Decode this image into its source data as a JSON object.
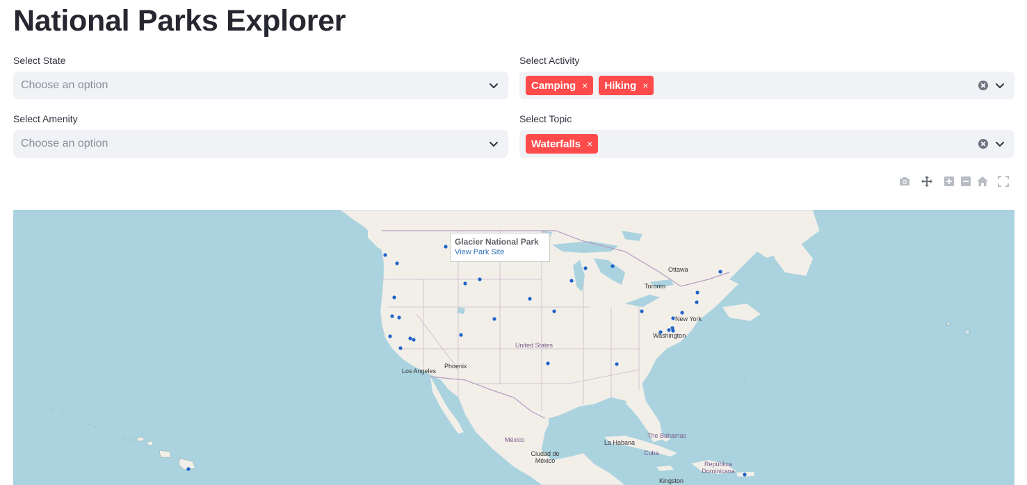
{
  "page": {
    "title": "National Parks Explorer"
  },
  "filters": {
    "state": {
      "label": "Select State",
      "placeholder": "Choose an option"
    },
    "activity": {
      "label": "Select Activity",
      "tags": [
        "Camping",
        "Hiking"
      ]
    },
    "amenity": {
      "label": "Select Amenity",
      "placeholder": "Choose an option"
    },
    "topic": {
      "label": "Select Topic",
      "tags": [
        "Waterfalls"
      ]
    }
  },
  "tag_remove_glyph": "×",
  "modebar": {
    "icons": [
      "camera-icon",
      "pan-icon",
      "zoom-in-icon",
      "zoom-out-icon",
      "home-icon",
      "fullscreen-icon"
    ]
  },
  "map": {
    "tooltip": {
      "title": "Glacier National Park",
      "link": "View Park Site"
    },
    "place_labels": {
      "ottawa": "Ottawa",
      "toronto": "Toronto",
      "new_york": "New York",
      "washington": "Washington",
      "united_states": "United States",
      "phoenix": "Phoenix",
      "los_angeles": "Los Angeles",
      "mexico": "México",
      "ciudad_de_mexico": "Ciudad de México",
      "la_habana": "La Habana",
      "cuba": "Cuba",
      "the_bahamas": "The Bahamas",
      "republica_dominicana": "República Dominicana",
      "kingston": "Kingston"
    },
    "colors": {
      "water": "#aad3df",
      "land": "#f2efe9",
      "marker": "#1f62c9",
      "border": "#c9b8c9"
    }
  }
}
